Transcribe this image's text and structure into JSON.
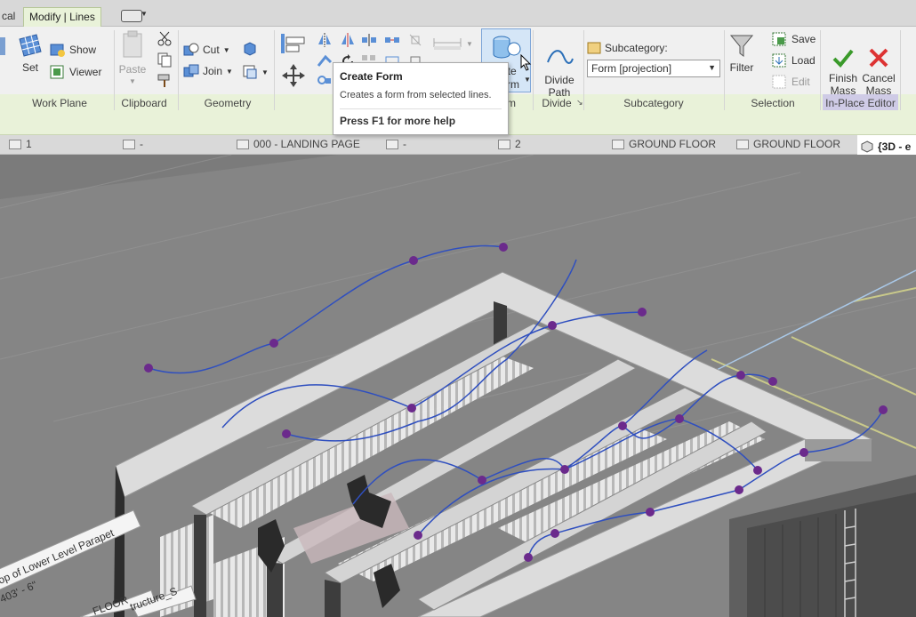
{
  "tabs": {
    "partial_left": "cal",
    "active": "Modify | Lines"
  },
  "ribbon": {
    "work_plane": {
      "title": "Work Plane",
      "set": "Set",
      "show": "Show",
      "viewer": "Viewer"
    },
    "clipboard": {
      "title": "Clipboard",
      "paste": "Paste"
    },
    "geometry": {
      "title": "Geometry",
      "cut": "Cut",
      "join": "Join"
    },
    "form": {
      "title_partial": "m",
      "create_form_partial": "ate",
      "create_form_partial2": "rm"
    },
    "divide": {
      "title": "Divide",
      "divide_path": "Divide\nPath"
    },
    "subcategory": {
      "title": "Subcategory",
      "label": "Subcategory:",
      "value": "Form [projection]"
    },
    "selection": {
      "title": "Selection",
      "filter": "Filter",
      "save": "Save",
      "load": "Load",
      "edit": "Edit"
    },
    "inplace": {
      "title": "In-Place Editor",
      "finish": "Finish\nMass",
      "cancel": "Cancel\nMass"
    }
  },
  "tooltip": {
    "title": "Create Form",
    "description": "Creates a form from selected lines.",
    "help": "Press F1 for more help"
  },
  "view_tabs": [
    {
      "label": "1"
    },
    {
      "label": "-"
    },
    {
      "label": "000 - LANDING PAGE"
    },
    {
      "label": "-"
    },
    {
      "label": "2"
    },
    {
      "label": "GROUND FLOOR"
    },
    {
      "label": "GROUND FLOOR"
    },
    {
      "label": "{3D - e"
    }
  ],
  "viewport": {
    "labels": {
      "parapet": "op of Lower Level Parapet",
      "elev": "403' - 6\"",
      "floor": "FLOOR",
      "structure": "tructure_S"
    }
  },
  "colors": {
    "ribbon_bg": "#f0f0f0",
    "panel_title_bg": "#e9f2d9",
    "curve_blue": "#2f4fbf",
    "point_purple": "#6b2a8c",
    "finish_green": "#3a9a2a",
    "cancel_red": "#d33"
  }
}
